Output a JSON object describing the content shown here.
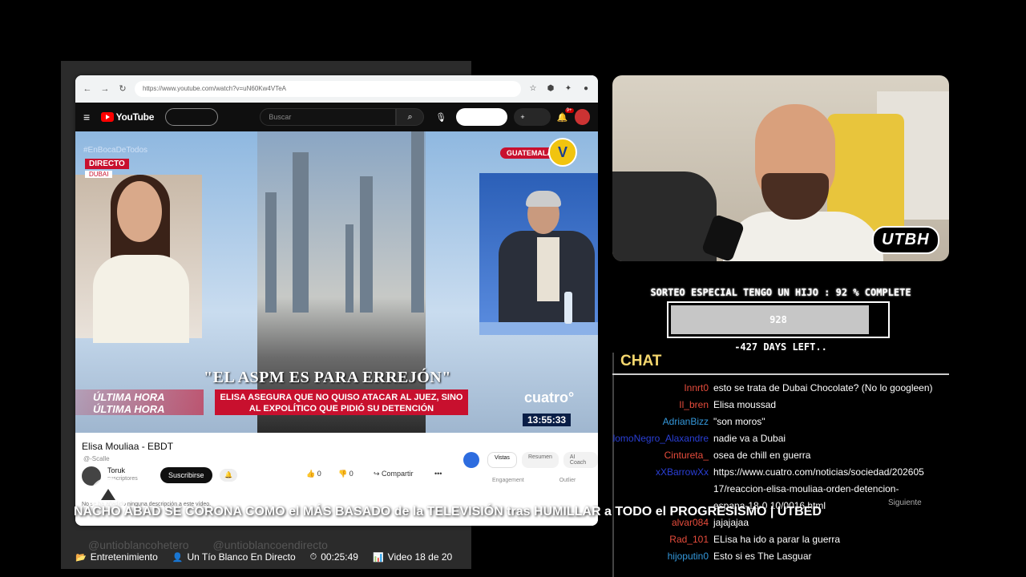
{
  "browser": {
    "url": "https://www.youtube.com/watch?v=uN60Kw4VTeA"
  },
  "youtube": {
    "logo_text": "YouTube",
    "search_placeholder": "Buscar",
    "create_label": "+ Crear",
    "bell_badge": "9+"
  },
  "video": {
    "hashtag": "#EnBocaDeTodos",
    "live_badge": "DIRECTO",
    "location": "DUBAI",
    "region": "GUATEMALA",
    "channel_logo": "V",
    "headline": "\"EL ASPM ES PARA ERREJÓN\"",
    "subheadline": "ELISA ASEGURA QUE NO QUISO ATACAR AL JUEZ, SINO AL EXPOLÍTICO QUE PIDIÓ SU DETENCIÓN",
    "ticker": "ÚLTIMA HORA ÚLTIMA HORA ÚLTIMA H",
    "network": "cuatro°",
    "clock": "13:55:33"
  },
  "below_video": {
    "title": "Elisa Mouliaa - EBDT",
    "subtitle": "@-Scalle",
    "channel_name": "Toruk",
    "channel_subs": "suscriptores",
    "subscribe_label": "Suscribirse",
    "like_label": "👍 0",
    "dislike_label": "👎 0",
    "share_label": "↪ Compartir",
    "more_label": "•••",
    "description": "No se ha añadido ninguna descripción a este vídeo.",
    "side_tabs": [
      "Vistas",
      "Resumen",
      "AI Coach"
    ],
    "side_labels": [
      "Engagement",
      "Outlier"
    ],
    "watermark_1": "@untioblancohetero",
    "watermark_2": "@untioblancoendirecto"
  },
  "webcam": {
    "logo": "UTBH"
  },
  "goal": {
    "title": "SORTEO ESPECIAL TENGO UN HIJO :  92 % COMPLETE",
    "percent": 92,
    "value": "928",
    "days_left": "-427 DAYS LEFT.."
  },
  "chat": {
    "header": "CHAT",
    "messages": [
      {
        "user": "Innrt0",
        "text": "esto se trata de Dubai Chocolate? (No lo googleen)",
        "color": "#e74c3c"
      },
      {
        "user": "Il_bren",
        "text": "Elisa moussad",
        "color": "#e74c3c"
      },
      {
        "user": "AdrianBizz",
        "text": "\"son moros\"",
        "color": "#3498db"
      },
      {
        "user": "PalomoNegro_Alaxandre",
        "text": "nadie va a Dubai",
        "color": "#2a3fd6"
      },
      {
        "user": "Cintureta_",
        "text": "osea de chill en guerra",
        "color": "#e74c3c"
      },
      {
        "user": "xXBarrowXx",
        "text": "https://www.cuatro.com/noticias/sociedad/202605",
        "color": "#2a3fd6"
      },
      {
        "user": "",
        "text": "17/reaccion-elisa-mouliaa-orden-detencion-",
        "color": "#fff"
      },
      {
        "user": "",
        "text": "espana-18-0 10/0016.html",
        "color": "#fff"
      },
      {
        "user": "alvar084",
        "text": "jajajajaa",
        "color": "#e74c3c"
      },
      {
        "user": "Rad_101",
        "text": "ELisa ha ido a parar la guerra",
        "color": "#e74c3c"
      },
      {
        "user": "hijoputin0",
        "text": "Esto si es The Lasguar",
        "color": "#3498db"
      }
    ]
  },
  "overlay": {
    "video_title": "NACHO ABAD SE CORONA COMO el MÁS BASADO de la TELEVISIÓN tras HUMILLAR a TODO el PROGRESISMO | UTBED",
    "next_label": "Siguiente",
    "category": "Entretenimiento",
    "channel": "Un Tío Blanco En Directo",
    "duration": "00:25:49",
    "position": "Video 18 de 20"
  }
}
